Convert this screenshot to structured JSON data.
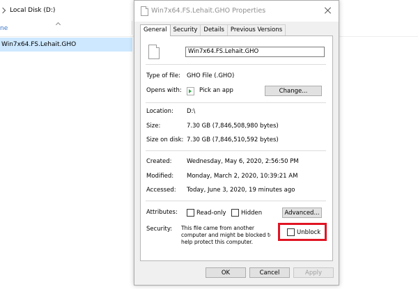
{
  "explorer": {
    "breadcrumb": "Local Disk (D:)",
    "name_column": "ne",
    "file_item": "Win7x64.FS.Lehait.GHO"
  },
  "dialog": {
    "title": "Win7x64.FS.Lehait.GHO Properties",
    "tabs": [
      {
        "label": "General"
      },
      {
        "label": "Security"
      },
      {
        "label": "Details"
      },
      {
        "label": "Previous Versions"
      }
    ],
    "file_name": "Win7x64.FS.Lehait.GHO",
    "type_of_file": {
      "label": "Type of file:",
      "value": "GHO File (.GHO)"
    },
    "opens_with": {
      "label": "Opens with:",
      "value": "Pick an app",
      "button": "Change..."
    },
    "location": {
      "label": "Location:",
      "value": "D:\\"
    },
    "size": {
      "label": "Size:",
      "value": "7.30 GB (7,846,508,980 bytes)"
    },
    "size_on_disk": {
      "label": "Size on disk:",
      "value": "7.30 GB (7,846,510,592 bytes)"
    },
    "created": {
      "label": "Created:",
      "value": "Wednesday, May 6, 2020, 2:56:50 PM"
    },
    "modified": {
      "label": "Modified:",
      "value": "Monday, March 2, 2020, 10:39:21 AM"
    },
    "accessed": {
      "label": "Accessed:",
      "value": "Today, June 3, 2020, 19 minutes ago"
    },
    "attributes": {
      "label": "Attributes:",
      "readonly": "Read-only",
      "hidden": "Hidden",
      "advanced_button": "Advanced..."
    },
    "security": {
      "label": "Security:",
      "line1": "This file came from another",
      "line2": "computer and might be blocked to",
      "line3": "help protect this computer.",
      "unblock": "Unblock"
    },
    "buttons": {
      "ok": "OK",
      "cancel": "Cancel",
      "apply": "Apply"
    },
    "highlight_color": "#e01423"
  }
}
